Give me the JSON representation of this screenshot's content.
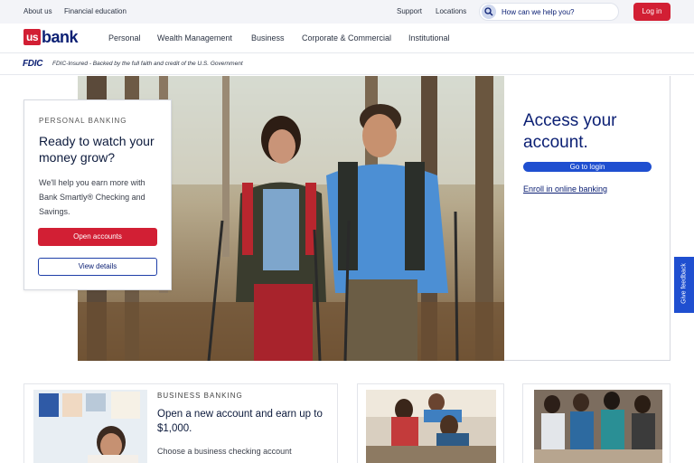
{
  "utility": {
    "links_left": [
      "About us",
      "Financial education"
    ],
    "support": "Support",
    "locations": "Locations",
    "search_placeholder": "How can we help you?",
    "login": "Log in"
  },
  "brand": {
    "logo_us": "us",
    "logo_bank": "bank",
    "red": "#d21f34",
    "navy": "#0c2074",
    "blue": "#1f4fd0"
  },
  "nav": {
    "items": [
      "Personal",
      "Wealth Management",
      "Business",
      "Corporate & Commercial",
      "Institutional"
    ]
  },
  "fdic": {
    "logo": "FDIC",
    "text": "FDIC-Insured - Backed by the full faith and credit of the U.S. Government"
  },
  "promo": {
    "eyebrow": "PERSONAL BANKING",
    "title": "Ready to watch your money grow?",
    "body": "We'll help you earn more with Bank Smartly® Checking and Savings.",
    "primary": "Open accounts",
    "secondary": "View details"
  },
  "access": {
    "title": "Access your account.",
    "go": "Go to login",
    "enroll": "Enroll in online banking"
  },
  "feedback": "Give feedback",
  "cards": {
    "business": {
      "eyebrow": "BUSINESS BANKING",
      "title": "Open a new account and earn up to $1,000.",
      "body": "Choose a business checking account"
    }
  }
}
